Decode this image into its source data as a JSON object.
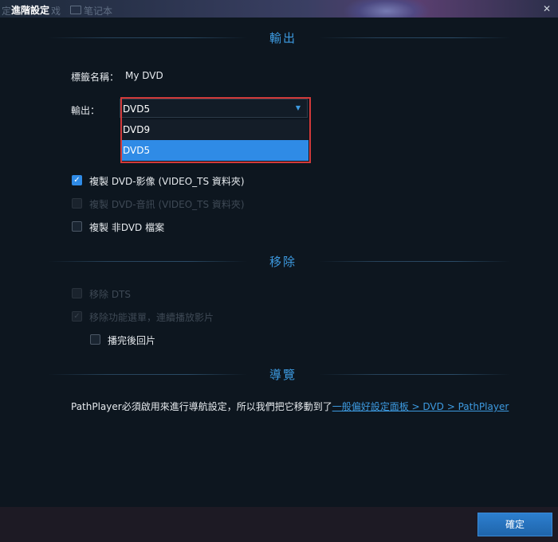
{
  "window": {
    "title": "進階設定",
    "background_text_left": "定",
    "background_text_mid": "戏",
    "background_text_notes": "笔记本",
    "close_glyph": "✕"
  },
  "output_section": {
    "header": "輸出",
    "label_name_label": "標籤名稱：",
    "label_name_value": "My DVD",
    "output_label": "輸出：",
    "output_selected": "DVD5",
    "options": [
      "DVD9",
      "DVD5"
    ],
    "highlighted_option": "DVD5"
  },
  "copy_options": [
    {
      "label": "複製 DVD-影像 (VIDEO_TS 資料夾)",
      "checked": true,
      "enabled": true
    },
    {
      "label": "複製 DVD-音訊 (VIDEO_TS 資料夾)",
      "checked": false,
      "enabled": false
    },
    {
      "label": "複製 非DVD 檔案",
      "checked": false,
      "enabled": true
    }
  ],
  "remove_section": {
    "header": "移除",
    "options": [
      {
        "label": "移除 DTS",
        "checked": false,
        "enabled": false
      },
      {
        "label": "移除功能選單，連續播放影片",
        "checked": true,
        "enabled": false
      },
      {
        "label": "播完後回片",
        "checked": false,
        "enabled": true
      }
    ]
  },
  "navigation_section": {
    "header": "導覽",
    "info_text": "PathPlayer必須啟用來進行導航設定，所以我們把它移動到了",
    "info_link": "一般偏好設定面板 > DVD > PathPlayer"
  },
  "footer": {
    "ok_label": "確定"
  },
  "colors": {
    "accent": "#2f8be6",
    "dropdown_highlight_border": "#d23a3a",
    "background": "#0d161f"
  }
}
